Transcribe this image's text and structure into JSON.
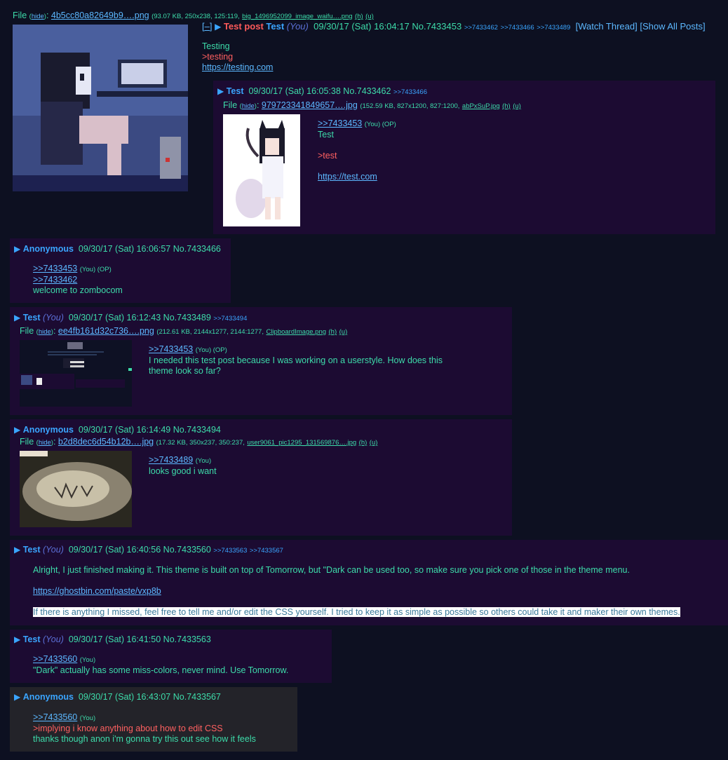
{
  "op": {
    "file_label": "File",
    "hide_label": "hide",
    "filename": "4b5cc80a82649b9….png",
    "filemeta": "(93.07 KB, 250x238, 125:119,",
    "orig_name": "big_1496952099_image_waifu….png",
    "h": "(h)",
    "u": "(u)",
    "collapse": "[–]",
    "subject": "Test post",
    "name": "Test",
    "you": "(You)",
    "date": "09/30/17 (Sat) 16:04:17",
    "no": "No.7433453",
    "backlinks": [
      ">>7433462",
      ">>7433466",
      ">>7433489"
    ],
    "watch": "[Watch Thread]",
    "show_all": "[Show All Posts]",
    "line1": "Testing",
    "line2": ">testing",
    "line3": "https://testing.com"
  },
  "posts": [
    {
      "name": "Test",
      "date": "09/30/17 (Sat) 16:05:38",
      "no": "No.7433462",
      "backlink": ">>7433466",
      "file_label": "File",
      "hide_label": "hide",
      "filename": "979723341849657….jpg",
      "filemeta": "(152.59 KB, 827x1200, 827:1200,",
      "orig_name": "abPxSuP.jpg",
      "h": "(h)",
      "u": "(u)",
      "quote": ">>7433453",
      "quote_tag": "(You) (OP)",
      "line1": "Test",
      "line2": ">test",
      "line3": "https://test.com"
    },
    {
      "name": "Anonymous",
      "date": "09/30/17 (Sat) 16:06:57",
      "no": "No.7433466",
      "quote1": ">>7433453",
      "quote1_tag": "(You) (OP)",
      "quote2": ">>7433462",
      "line1": "welcome to zombocom"
    },
    {
      "name": "Test",
      "you": "(You)",
      "date": "09/30/17 (Sat) 16:12:43",
      "no": "No.7433489",
      "backlink": ">>7433494",
      "file_label": "File",
      "hide_label": "hide",
      "filename": "ee4fb161d32c736….png",
      "filemeta": "(212.61 KB, 2144x1277, 2144:1277,",
      "orig_name": "ClipboardImage.png",
      "h": "(h)",
      "u": "(u)",
      "quote": ">>7433453",
      "quote_tag": "(You) (OP)",
      "line1": "I needed this test post because I was working on a userstyle. How does this",
      "line2": "theme look so far?"
    },
    {
      "name": "Anonymous",
      "date": "09/30/17 (Sat) 16:14:49",
      "no": "No.7433494",
      "file_label": "File",
      "hide_label": "hide",
      "filename": "b2d8dec6d54b12b….jpg",
      "filemeta": "(17.32 KB, 350x237, 350:237,",
      "orig_name": "user9061_pic1295_131569876….jpg",
      "h": "(h)",
      "u": "(u)",
      "quote": ">>7433489",
      "quote_tag": "(You)",
      "line1": "looks good i want"
    },
    {
      "name": "Test",
      "you": "(You)",
      "date": "09/30/17 (Sat) 16:40:56",
      "no": "No.7433560",
      "backlinks": [
        ">>7433563",
        ">>7433567"
      ],
      "line1": "Alright, I just finished making it. This theme is built on top of Tomorrow, but \"Dark can be used too, so make sure you pick one of those in the theme menu.",
      "line2": "https://ghostbin.com/paste/vxp8b",
      "line3": "If there is anything I missed, feel free to tell me and/or edit the CSS yourself. I tried to keep it as simple as possible so others could take it and maker their own themes."
    },
    {
      "name": "Test",
      "you": "(You)",
      "date": "09/30/17 (Sat) 16:41:50",
      "no": "No.7433563",
      "quote": ">>7433560",
      "quote_tag": "(You)",
      "line1": "\"Dark\" actually has some miss-colors, never mind. Use Tomorrow."
    },
    {
      "name": "Anonymous",
      "date": "09/30/17 (Sat) 16:43:07",
      "no": "No.7433567",
      "quote": ">>7433560",
      "quote_tag": "(You)",
      "line1": ">implying i know anything about how to edit CSS",
      "line2": "thanks though anon i'm gonna try this out see how it feels"
    }
  ],
  "colors": {
    "page_bg": "#0d1021",
    "post_bg": "#1c0b32",
    "post_alt_bg": "#232329",
    "text": "#3ddcaa",
    "name": "#3aa5ff",
    "link": "#5cb8ff",
    "greentext": "#ff6060",
    "subject": "#ff5a5a"
  }
}
